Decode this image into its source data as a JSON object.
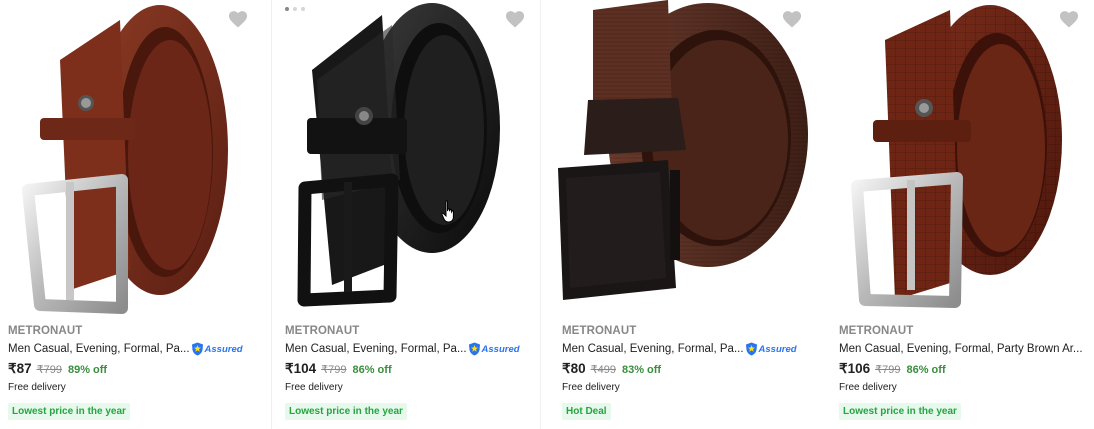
{
  "products": [
    {
      "brand": "METRONAUT",
      "title": "Men Casual, Evening, Formal, Pa...",
      "assured": true,
      "assured_label": "Assured",
      "price": "₹87",
      "mrp": "₹799",
      "discount": "89% off",
      "delivery": "Free delivery",
      "badge": "Lowest price in the year",
      "image_desc": "brown textured leather belt silver buckle",
      "wishlist_icon": "heart-icon"
    },
    {
      "brand": "METRONAUT",
      "title": "Men Casual, Evening, Formal, Pa...",
      "assured": true,
      "assured_label": "Assured",
      "price": "₹104",
      "mrp": "₹799",
      "discount": "86% off",
      "delivery": "Free delivery",
      "badge": "Lowest price in the year",
      "image_desc": "black croc leather belt black buckle",
      "wishlist_icon": "heart-icon"
    },
    {
      "brand": "METRONAUT",
      "title": "Men Casual, Evening, Formal, Pa...",
      "assured": true,
      "assured_label": "Assured",
      "price": "₹80",
      "mrp": "₹499",
      "discount": "83% off",
      "delivery": "Free delivery",
      "badge": "Hot Deal",
      "image_desc": "brown nylon webbing belt black plate buckle",
      "wishlist_icon": "heart-icon"
    },
    {
      "brand": "METRONAUT",
      "title": "Men Casual, Evening, Formal, Party Brown Ar...",
      "assured": false,
      "price": "₹106",
      "mrp": "₹799",
      "discount": "86% off",
      "delivery": "Free delivery",
      "badge": "Lowest price in the year",
      "image_desc": "brown croc leather belt silver buckle",
      "wishlist_icon": "heart-icon"
    }
  ],
  "colors": {
    "discount_green": "#388e3c",
    "badge_bg": "#e7f8ec",
    "badge_text": "#26a541",
    "assured_blue": "#2874f0",
    "brand_grey": "#878787"
  }
}
